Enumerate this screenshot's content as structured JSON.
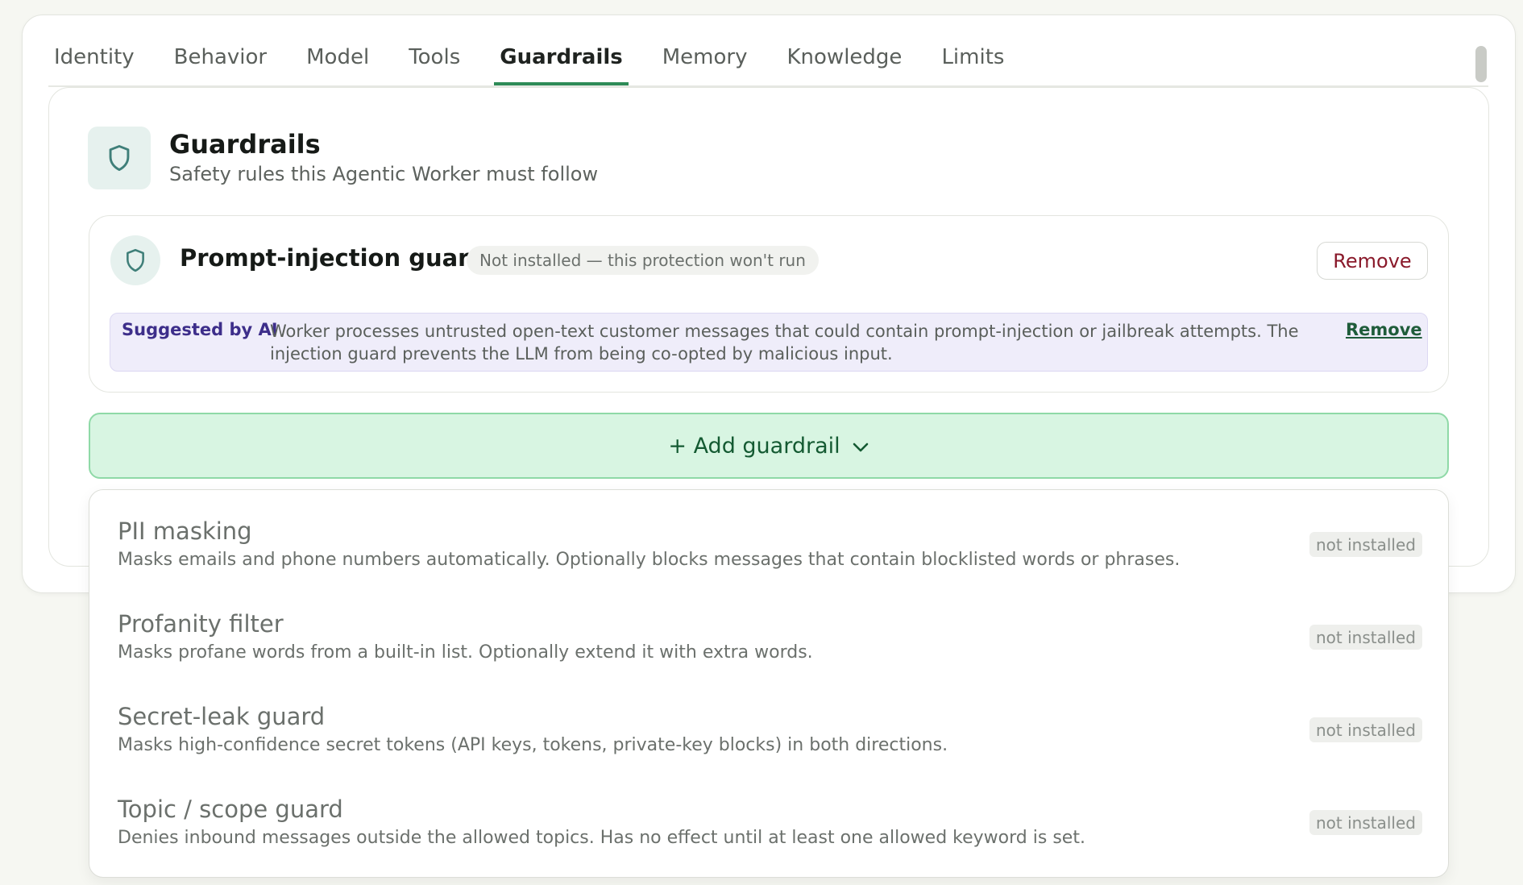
{
  "tabs": [
    {
      "label": "Identity",
      "active": false
    },
    {
      "label": "Behavior",
      "active": false
    },
    {
      "label": "Model",
      "active": false
    },
    {
      "label": "Tools",
      "active": false
    },
    {
      "label": "Guardrails",
      "active": true
    },
    {
      "label": "Memory",
      "active": false
    },
    {
      "label": "Knowledge",
      "active": false
    },
    {
      "label": "Limits",
      "active": false
    }
  ],
  "header": {
    "title": "Guardrails",
    "subtitle": "Safety rules this Agentic Worker must follow",
    "icon": "shield-icon"
  },
  "guard": {
    "title": "Prompt-injection guard",
    "status": "Not installed — this protection won't run",
    "remove_label": "Remove",
    "icon": "shield-icon",
    "suggestion": {
      "label": "Suggested by AI",
      "text": "Worker processes untrusted open-text customer messages that could contain prompt-injection or jailbreak attempts. The injection guard prevents the LLM from being co-opted by malicious input.",
      "remove_label": "Remove"
    }
  },
  "add_button": {
    "label": "+ Add guardrail",
    "icon": "chevron-down-icon"
  },
  "options": [
    {
      "title": "PII masking",
      "description": "Masks emails and phone numbers automatically. Optionally blocks messages that contain blocklisted words or phrases.",
      "badge": "not installed"
    },
    {
      "title": "Profanity filter",
      "description": "Masks profane words from a built-in list. Optionally extend it with extra words.",
      "badge": "not installed"
    },
    {
      "title": "Secret-leak guard",
      "description": "Masks high-confidence secret tokens (API keys, tokens, private-key blocks) in both directions.",
      "badge": "not installed"
    },
    {
      "title": "Topic / scope guard",
      "description": "Denies inbound messages outside the allowed topics. Has no effect until at least one allowed keyword is set.",
      "badge": "not installed"
    }
  ],
  "colors": {
    "accent": "#2e8b57",
    "shield": "#3f7f79",
    "remove": "#8a1a2b",
    "ai_label": "#3d2e8a",
    "add_bg": "#d8f5e2"
  }
}
